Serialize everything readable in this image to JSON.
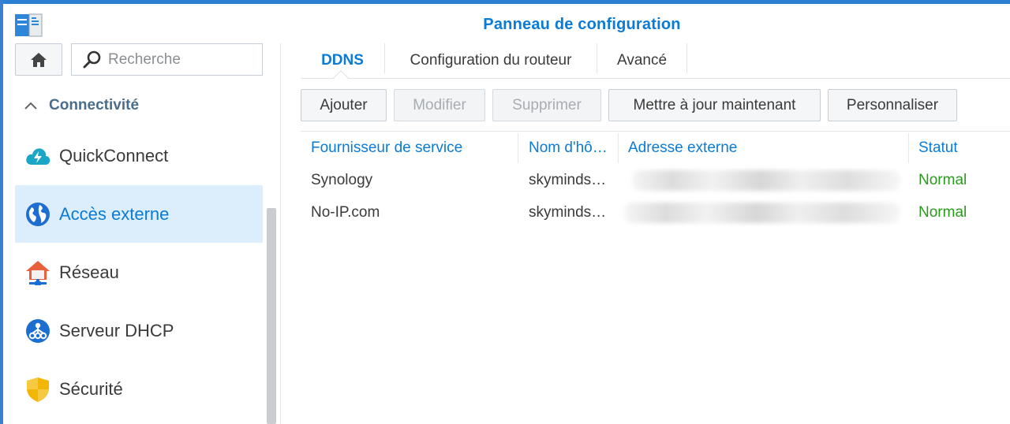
{
  "window": {
    "title": "Panneau de configuration"
  },
  "sidebar": {
    "search_placeholder": "Recherche",
    "section_label": "Connectivité",
    "items": [
      {
        "label": "QuickConnect",
        "icon": "quickconnect-icon"
      },
      {
        "label": "Accès externe",
        "icon": "globe-icon",
        "active": true
      },
      {
        "label": "Réseau",
        "icon": "network-house-icon"
      },
      {
        "label": "Serveur DHCP",
        "icon": "dhcp-icon"
      },
      {
        "label": "Sécurité",
        "icon": "shield-icon"
      }
    ]
  },
  "tabs": [
    {
      "label": "DDNS",
      "active": true
    },
    {
      "label": "Configuration du routeur"
    },
    {
      "label": "Avancé"
    }
  ],
  "toolbar": {
    "add": "Ajouter",
    "edit": "Modifier",
    "delete": "Supprimer",
    "update_now": "Mettre à jour maintenant",
    "customize": "Personnaliser"
  },
  "table": {
    "columns": [
      "Fournisseur de service",
      "Nom d'hô…",
      "Adresse externe",
      "Statut"
    ],
    "rows": [
      {
        "provider": "Synology",
        "hostname": "skyminds…",
        "external_address": "",
        "status": "Normal"
      },
      {
        "provider": "No-IP.com",
        "hostname": "skyminds…",
        "external_address": "",
        "status": "Normal"
      }
    ]
  },
  "colors": {
    "accent": "#0a7bd6",
    "status_ok": "#2a9a1e",
    "active_item_bg": "#dcedfb"
  }
}
